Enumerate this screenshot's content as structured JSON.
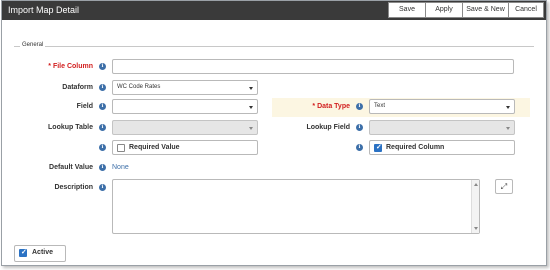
{
  "window": {
    "title": "Import Map Detail",
    "buttons": {
      "save": "Save",
      "apply": "Apply",
      "save_new": "Save & New",
      "cancel": "Cancel"
    }
  },
  "section": {
    "legend": "General"
  },
  "info_icon_glyph": "i",
  "fields": {
    "file_column": {
      "label": "File Column",
      "required": true,
      "value": ""
    },
    "dataform": {
      "label": "Dataform",
      "value": "WC Code Rates"
    },
    "field": {
      "label": "Field",
      "value": ""
    },
    "data_type": {
      "label": "Data Type",
      "required": true,
      "value": "Text"
    },
    "lookup_table": {
      "label": "Lookup Table",
      "value": "",
      "disabled": true
    },
    "lookup_field": {
      "label": "Lookup Field",
      "value": "",
      "disabled": true
    },
    "required_value": {
      "label": "Required Value",
      "checked": false
    },
    "required_column": {
      "label": "Required Column",
      "checked": true
    },
    "default_value": {
      "label": "Default Value",
      "value": "None"
    },
    "description": {
      "label": "Description",
      "value": ""
    },
    "active": {
      "label": "Active",
      "checked": true
    }
  },
  "required_marker": "*",
  "icons": [
    "info-icon",
    "chevron-down-icon",
    "checkbox-icon",
    "expand-icon",
    "scroll-up-arrow-icon",
    "scroll-down-arrow-icon"
  ],
  "colors": {
    "titlebar": "#3a3a3a",
    "required": "#d21f1f",
    "accent": "#2b72c4",
    "link": "#3d6fa8",
    "highlight": "#fcf6e2"
  }
}
